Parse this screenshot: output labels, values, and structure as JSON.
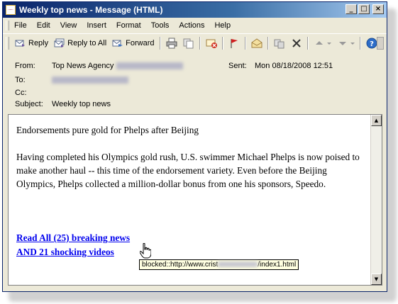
{
  "window": {
    "title": "Weekly top news - Message (HTML)",
    "controls": {
      "minimize": "_",
      "maximize": "□",
      "close": "×"
    }
  },
  "menu": [
    "File",
    "Edit",
    "View",
    "Insert",
    "Format",
    "Tools",
    "Actions",
    "Help"
  ],
  "toolbar": {
    "reply": "Reply",
    "reply_all": "Reply to All",
    "forward": "Forward"
  },
  "header": {
    "from_label": "From:",
    "from_value": "Top News Agency",
    "sent_label": "Sent:",
    "sent_value": "Mon 08/18/2008 12:51",
    "to_label": "To:",
    "cc_label": "Cc:",
    "subject_label": "Subject:",
    "subject_value": "Weekly top news"
  },
  "body": {
    "headline": "Endorsements pure gold for Phelps after Beijing",
    "paragraph": "Having completed his Olympics gold rush, U.S. swimmer Michael Phelps is now poised to make another haul -- this time of the endorsement variety. Even before the Beijing Olympics, Phelps collected a million-dollar bonus from one his sponsors, Speedo.",
    "link_line1": "Read All (25) breaking news",
    "link_line2": "AND 21 shocking videos"
  },
  "tooltip": {
    "prefix": "blocked::http://www.crist",
    "suffix": "/index1.html"
  }
}
